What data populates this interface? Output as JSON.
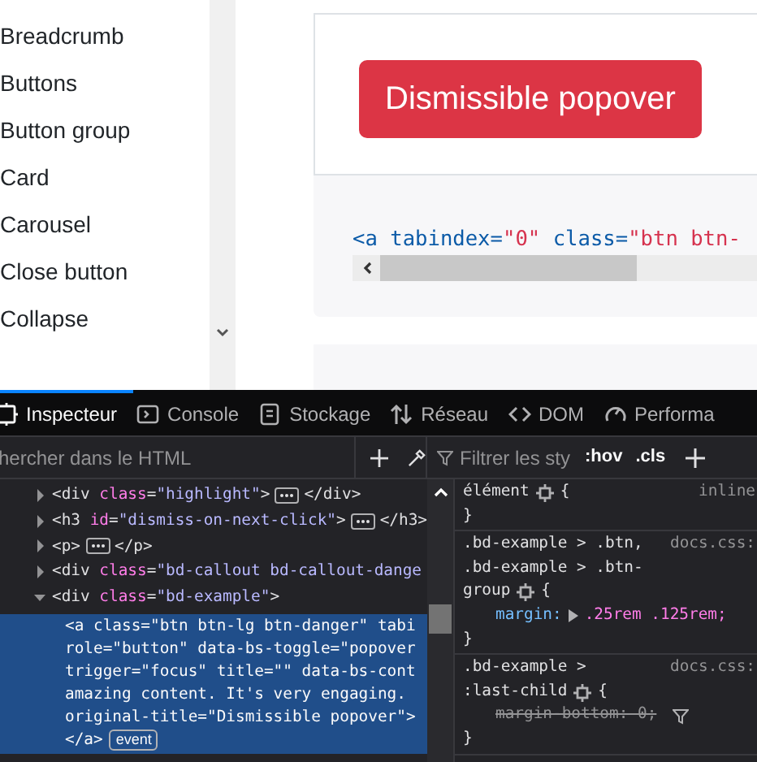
{
  "sidebar": {
    "items": [
      "Breadcrumb",
      "Buttons",
      "Button group",
      "Card",
      "Carousel",
      "Close button",
      "Collapse"
    ]
  },
  "example": {
    "button": "Dismissible popover",
    "code": "<a tabindex=\"0\" class=\"btn btn-"
  },
  "devtools": {
    "tabs": [
      {
        "label": "Inspecteur",
        "selected": true
      },
      {
        "label": "Console",
        "selected": false
      },
      {
        "label": "Stockage",
        "selected": false
      },
      {
        "label": "Réseau",
        "selected": false
      },
      {
        "label": "DOM",
        "selected": false
      },
      {
        "label": "Performa",
        "selected": false
      }
    ],
    "markup_search": {
      "placeholder": "hercher dans le HTML"
    },
    "rules_filter": {
      "placeholder": "Filtrer les sty"
    },
    "rules_buttons": [
      ":hov",
      ".cls"
    ],
    "markup": [
      {
        "text": "<div class=\"highlight\">",
        "close": "</div>",
        "expanded": false
      },
      {
        "text": "<h3 id=\"dismiss-on-next-click\">",
        "close": "</h3>",
        "expanded": false
      },
      {
        "text": "<p>",
        "close": "</p>",
        "expanded": false
      },
      {
        "text": "<div class=\"bd-callout bd-callout-dange",
        "expanded": false
      },
      {
        "text": "<div class=\"bd-example\">",
        "expanded": true,
        "children": [
          {
            "selected": true,
            "badge": "event",
            "lines": [
              "<a class=\"btn btn-lg btn-danger\" tabi",
              "role=\"button\" data-bs-toggle=\"popover",
              "trigger=\"focus\" title=\"\" data-bs-cont",
              "amazing content. It's very engaging.",
              "original-title=\"Dismissible popover\">",
              "</a>"
            ]
          }
        ]
      }
    ],
    "rules": [
      {
        "selector": [
          "élément"
        ],
        "open": "{",
        "close": "}",
        "source": "inline"
      },
      {
        "selector": [
          ".bd-example > .btn,",
          ".bd-example > .btn-",
          "group"
        ],
        "open": "{",
        "close": "}",
        "source": "docs.css:",
        "declarations": [
          {
            "property": "margin:",
            "value": ".25rem .125rem;",
            "overridden": false
          }
        ]
      },
      {
        "selector": [
          ".bd-example >",
          ":last-child"
        ],
        "open": "{",
        "close": "}",
        "source": "docs.css:",
        "declarations": [
          {
            "property": "margin-bottom:",
            "value": "0;",
            "overridden": true
          }
        ]
      }
    ]
  }
}
